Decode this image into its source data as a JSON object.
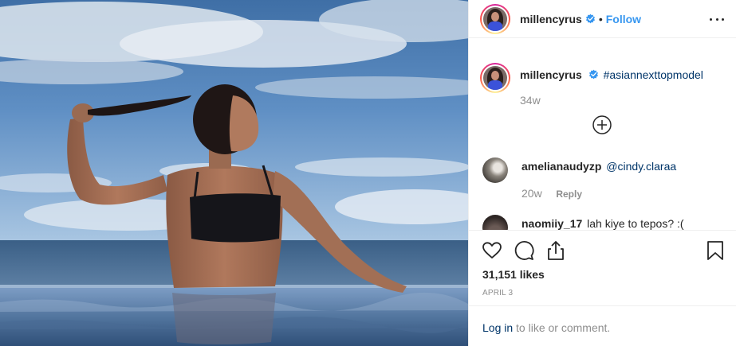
{
  "post": {
    "author": {
      "username": "millencyrus",
      "verified": true,
      "separator": "•",
      "follow_label": "Follow"
    },
    "caption": {
      "username": "millencyrus",
      "hashtag": "#asiannexttopmodel",
      "time_ago": "34w"
    },
    "comments": [
      {
        "username": "amelianaudyzp",
        "text": "@cindy.claraa",
        "time_ago": "20w",
        "reply_label": "Reply"
      },
      {
        "username": "naomiiy_17",
        "text": "lah kiye to tepos? :("
      }
    ],
    "likes": "31,151 likes",
    "date": "APRIL 3",
    "login_prompt": {
      "link": "Log in",
      "text": " to like or comment."
    }
  },
  "icons": {
    "more": "more-options-icon",
    "verified": "verified-badge-icon",
    "load_more": "load-more-comments-icon",
    "like": "heart-icon",
    "comment": "comment-icon",
    "share": "share-icon",
    "save": "bookmark-icon"
  },
  "colors": {
    "link_blue": "#3897f0",
    "hashtag_navy": "#003569",
    "muted_gray": "#8e8e8e",
    "text": "#262626"
  }
}
